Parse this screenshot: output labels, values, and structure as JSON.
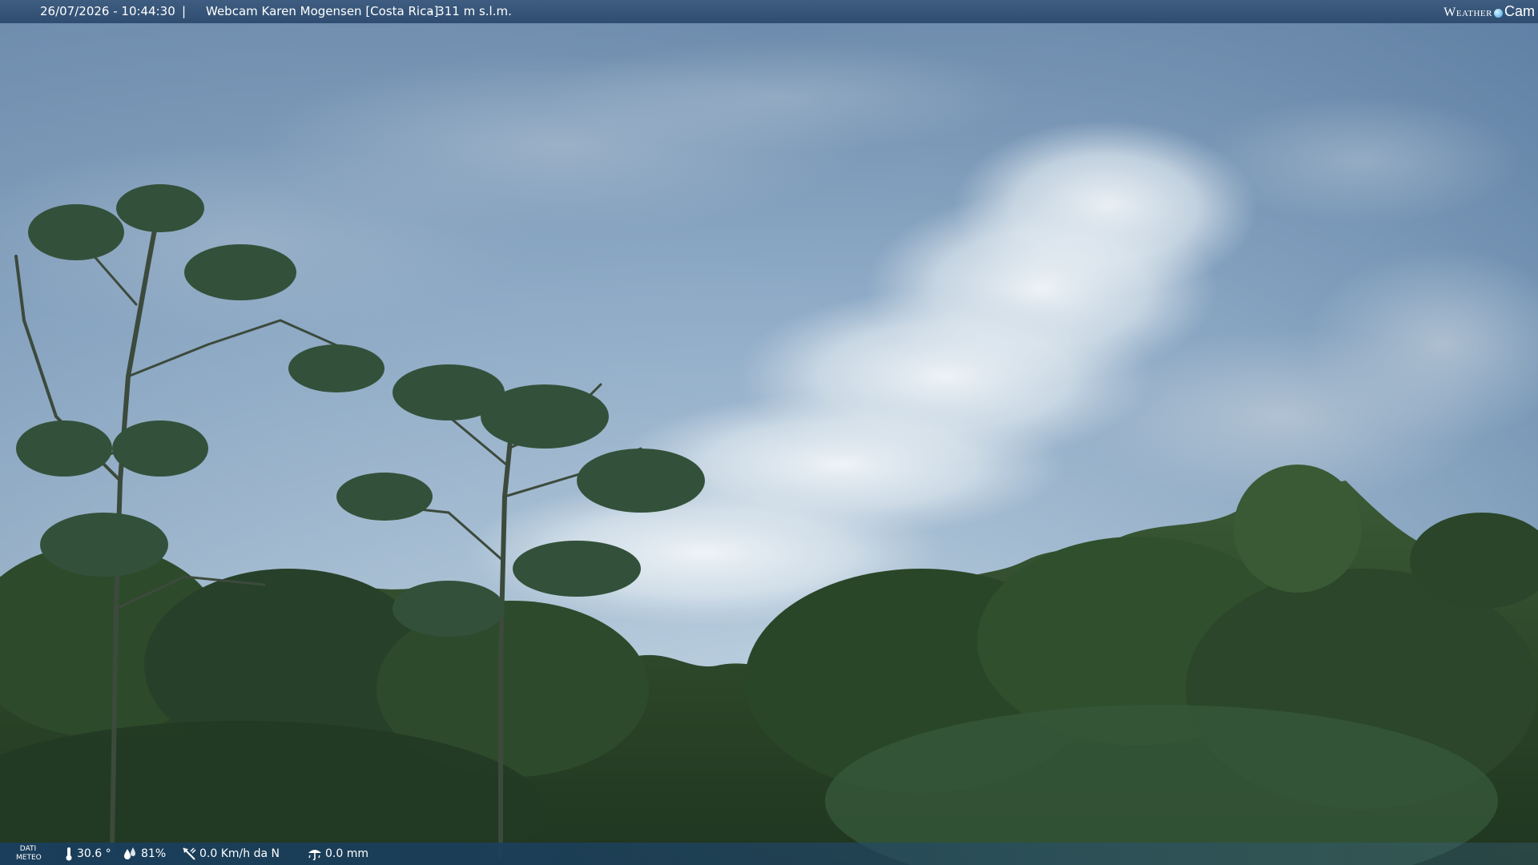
{
  "header": {
    "timestamp": "26/07/2026 - 10:44:30",
    "separator": "|",
    "title": "Webcam Karen Mogensen [Costa Rica]",
    "altitude": "- 311 m s.l.m.",
    "logo_weather": "Weather",
    "logo_cam": "Cam"
  },
  "weather_bar": {
    "label_line1": "DATI",
    "label_line2": "METEO",
    "temperature": "30.6 °",
    "humidity": "81%",
    "wind": "0.0 Km/h da N",
    "rain": "0.0 mm",
    "icons": [
      "thermometer-icon",
      "humidity-drops-icon",
      "wind-vane-icon",
      "rain-gauge-icon"
    ]
  },
  "colors": {
    "header_bg": "#34547a",
    "bar_bg": "#1a3e5e",
    "sky": "#8fb0cc",
    "foliage": "#2f4a2a"
  }
}
